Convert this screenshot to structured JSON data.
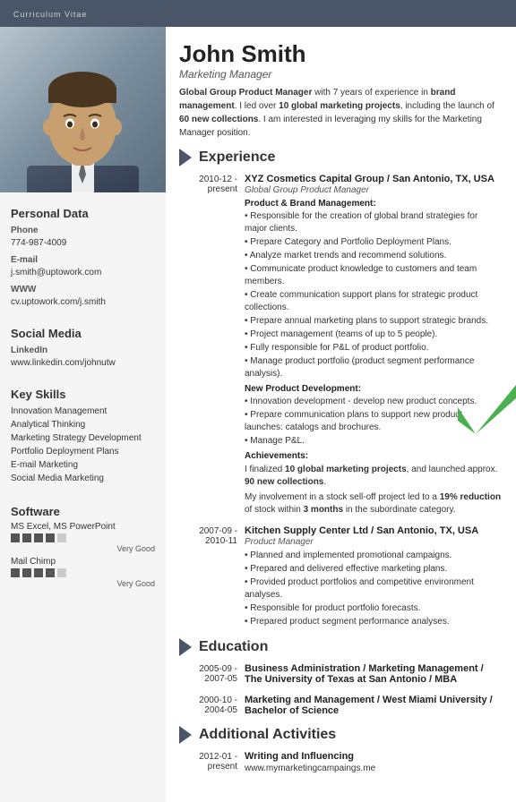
{
  "header": {
    "label": "Curriculum Vitae"
  },
  "profile": {
    "name": "John Smith",
    "title": "Marketing Manager",
    "summary": "Global Group Product Manager with 7 years of experience in brand management. I led over 10 global marketing projects, including the launch of 60 new collections. I am interested in leveraging my skills for the Marketing Manager position."
  },
  "personal": {
    "section_title": "Personal Data",
    "phone_label": "Phone",
    "phone": "774-987-4009",
    "email_label": "E-mail",
    "email": "j.smith@uptowork.com",
    "www_label": "WWW",
    "www": "cv.uptowork.com/j.smith"
  },
  "social": {
    "section_title": "Social Media",
    "linkedin_label": "LinkedIn",
    "linkedin": "www.linkedin.com/johnutw"
  },
  "skills": {
    "section_title": "Key Skills",
    "items": [
      "Innovation Management",
      "Analytical Thinking",
      "Marketing Strategy Development",
      "Portfolio Deployment Plans",
      "E-mail Marketing",
      "Social Media Marketing"
    ]
  },
  "software": {
    "section_title": "Software",
    "items": [
      {
        "name": "MS Excel, MS PowerPoint",
        "rating": 4,
        "max": 5,
        "rating_label": "Very Good"
      },
      {
        "name": "Mail Chimp",
        "rating": 4,
        "max": 5,
        "rating_label": "Very Good"
      }
    ]
  },
  "experience": {
    "section_title": "Experience",
    "entries": [
      {
        "date_start": "2010-12 -",
        "date_end": "present",
        "company": "XYZ Cosmetics Capital Group / San Antonio, TX, USA",
        "role": "Global Group Product Manager",
        "subsections": [
          {
            "title": "Product & Brand Management:",
            "bullets": [
              "• Responsible for the creation of global brand strategies for major clients.",
              "• Prepare Category and Portfolio Deployment Plans.",
              "• Analyze market trends and recommend solutions.",
              "• Communicate product knowledge to customers and team members.",
              "• Create communication support plans for strategic product collections.",
              "• Prepare annual marketing plans to support strategic brands.",
              "• Project management (teams of up to 5 people).",
              "• Fully responsible for P&L of product portfolio.",
              "• Manage product portfolio (product segment performance analysis)."
            ]
          },
          {
            "title": "New Product Development:",
            "bullets": [
              "• Innovation development - develop new product concepts.",
              "• Prepare communication plans to support new product launches: catalogs and brochures.",
              "• Manage P&L."
            ]
          },
          {
            "title": "Achievements:",
            "is_achievement": true,
            "text": "I finalized 10 global marketing projects, and launched approx. 90 new collections.",
            "text2": "My involvement in a stock sell-off project led to a 19% reduction of stock within 3 months in the subordinate category."
          }
        ]
      },
      {
        "date_start": "2007-09 -",
        "date_end": "2010-11",
        "company": "Kitchen Supply Center Ltd / San Antonio, TX, USA",
        "role": "Product Manager",
        "subsections": [
          {
            "title": "",
            "bullets": [
              "• Planned and implemented promotional campaigns.",
              "• Prepared and delivered effective marketing plans.",
              "• Provided product portfolios and competitive environment analyses.",
              "• Responsible for product portfolio forecasts.",
              "• Prepared product segment performance analyses."
            ]
          }
        ]
      }
    ]
  },
  "education": {
    "section_title": "Education",
    "entries": [
      {
        "date_start": "2005-09 -",
        "date_end": "2007-05",
        "degree": "Business Administration / Marketing Management / The University of Texas at San Antonio / MBA"
      },
      {
        "date_start": "2000-10 -",
        "date_end": "2004-05",
        "degree": "Marketing and Management / West Miami University / Bachelor of Science"
      }
    ]
  },
  "additional": {
    "section_title": "Additional Activities",
    "entries": [
      {
        "date_start": "2012-01 -",
        "date_end": "present",
        "activity": "Writing and Influencing",
        "detail": "www.mymarketingcampaings.me"
      }
    ]
  }
}
